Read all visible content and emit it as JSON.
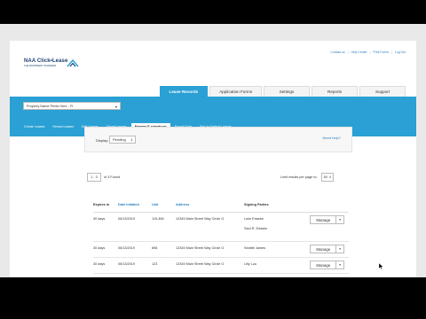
{
  "brand": {
    "name": "NAA Click•Lease",
    "tagline": "THE APARTMENT STANDARD"
  },
  "top_links": [
    "Contact us",
    "Help Center",
    "Print Forms",
    "Log Out"
  ],
  "main_tabs": [
    {
      "label": "Lease Records",
      "active": true
    },
    {
      "label": "Application Forms",
      "active": false
    },
    {
      "label": "Settings",
      "active": false
    },
    {
      "label": "Reports",
      "active": false
    },
    {
      "label": "Support",
      "active": false
    }
  ],
  "property_select": {
    "value": "Property Name Prints Here - FI"
  },
  "sub_nav": [
    {
      "label": "Create Leases",
      "active": false
    },
    {
      "label": "Renew Leases",
      "active": false
    },
    {
      "label": "Edit Leases",
      "active": false
    },
    {
      "label": "Saved Leases",
      "active": false
    },
    {
      "label": "Manage E-signatures",
      "active": true
    },
    {
      "label": "Export Data",
      "active": false
    },
    {
      "label": "Set Up Default Leases",
      "active": false
    }
  ],
  "filter": {
    "label": "Display:",
    "value": "Pending",
    "help": "Need help?"
  },
  "pagination": {
    "range": "1 - 3",
    "of_label": "of 3 Found"
  },
  "limit": {
    "label": "Limit results per page to:",
    "value": "50"
  },
  "table": {
    "headers": [
      "Expires in",
      "Date Initiated",
      "Unit",
      "Address",
      "Signing Parties"
    ],
    "rows": [
      {
        "expires": "30 days",
        "date": "06/13/2019",
        "unit": "115-456",
        "address": "12345 Main Street Way Circle G",
        "parties": [
          "Luke Erlaske",
          "Saul R. Erlaske"
        ],
        "action": "Manage"
      },
      {
        "expires": "30 days",
        "date": "06/13/2019",
        "unit": "898",
        "address": "12345 Main Street Way Circle G",
        "parties": [
          "Seattle James"
        ],
        "action": "Manage"
      },
      {
        "expires": "30 days",
        "date": "06/13/2019",
        "unit": "123",
        "address": "12345 Main Street Way Circle G",
        "parties": [
          "Lilly Luu"
        ],
        "action": "Manage"
      }
    ]
  },
  "colors": {
    "accent": "#2aa0d4",
    "link": "#2a7fc1",
    "logo": "#1b3f72"
  }
}
